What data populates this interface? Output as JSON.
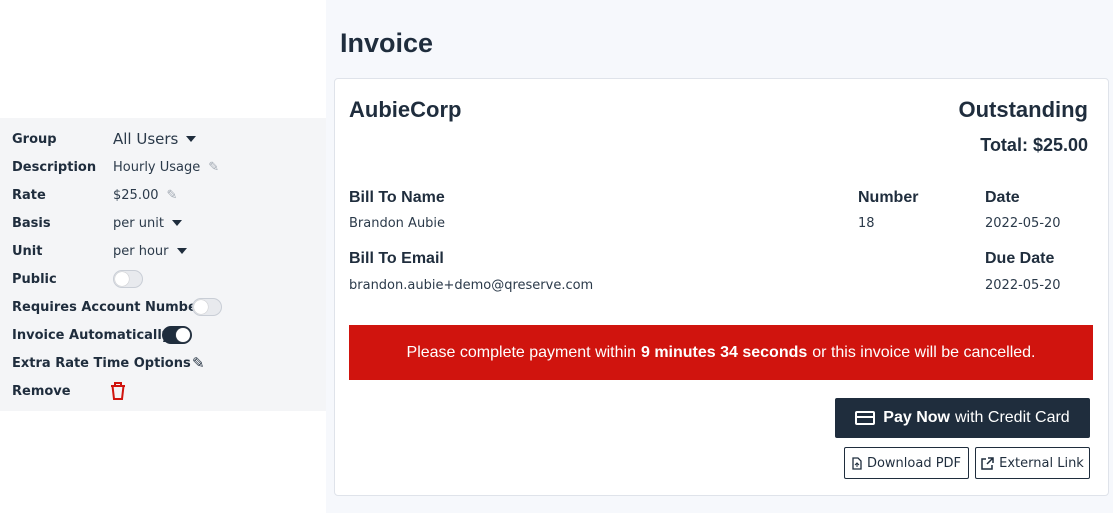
{
  "settings": {
    "rows": [
      {
        "label": "Group",
        "value": "All Users"
      },
      {
        "label": "Description",
        "value": "Hourly Usage"
      },
      {
        "label": "Rate",
        "value": "$25.00"
      },
      {
        "label": "Basis",
        "value": "per unit"
      },
      {
        "label": "Unit",
        "value": "per hour"
      },
      {
        "label": "Public",
        "toggle": false
      },
      {
        "label": "Requires Account Number",
        "toggle": false
      },
      {
        "label": "Invoice Automatically",
        "toggle": true
      },
      {
        "label": "Extra Rate Time Options"
      },
      {
        "label": "Remove"
      }
    ],
    "icons": {
      "edit": "pencil-icon",
      "remove": "trash-icon",
      "dropdown": "caret-down-icon"
    },
    "remove_color": "#d0140e"
  },
  "invoice": {
    "page_title": "Invoice",
    "company": "AubieCorp",
    "status": "Outstanding",
    "total_label": "Total:",
    "total_value": "$25.00",
    "bill_to_name_label": "Bill To Name",
    "bill_to_name": "Brandon Aubie",
    "number_label": "Number",
    "number": "18",
    "date_label": "Date",
    "date": "2022-05-20",
    "bill_to_email_label": "Bill To Email",
    "bill_to_email": "brandon.aubie+demo@qreserve.com",
    "due_date_label": "Due Date",
    "due_date": "2022-05-20"
  },
  "alert": {
    "prefix": "Please complete payment within",
    "countdown": "9 minutes 34 seconds",
    "suffix": "or this invoice will be cancelled.",
    "color": "#d0140e"
  },
  "actions": {
    "pay_bold": "Pay Now",
    "pay_rest": "with Credit Card",
    "download_pdf": "Download PDF",
    "external_link": "External Link"
  },
  "colors": {
    "primary": "#1f2d3d",
    "page_bg": "#f6f8fc"
  }
}
